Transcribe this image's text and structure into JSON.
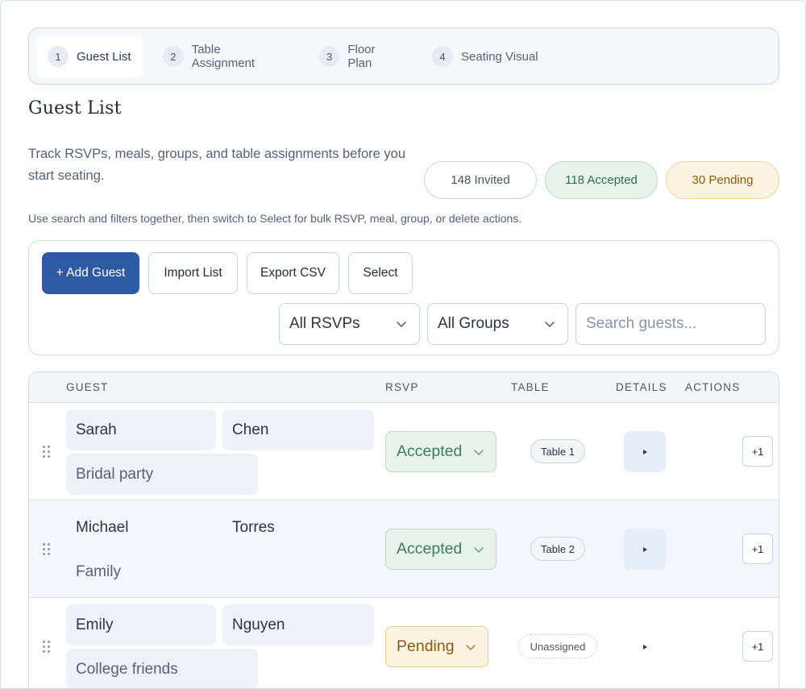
{
  "stepper": [
    {
      "num": "1",
      "label": "Guest List"
    },
    {
      "num": "2",
      "label": "Table Assignment"
    },
    {
      "num": "3",
      "label": "Floor Plan"
    },
    {
      "num": "4",
      "label": "Seating Visual"
    }
  ],
  "page_title": "Guest List",
  "intro": "Track RSVPs, meals, groups, and table assignments before you start seating.",
  "stats": {
    "invited": "148 Invited",
    "accepted": "118 Accepted",
    "pending": "30 Pending"
  },
  "hint": "Use search and filters together, then switch to Select for bulk RSVP, meal, group, or delete actions.",
  "toolbar": {
    "add_label": "+ Add Guest",
    "import_label": "Import List",
    "export_label": "Export CSV",
    "select_label": "Select",
    "rsvp_filter": "All RSVPs",
    "group_filter": "All Groups",
    "search_placeholder": "Search guests..."
  },
  "table": {
    "headers": {
      "guest": "GUEST",
      "rsvp": "RSVP",
      "table": "TABLE",
      "details": "DETAILS",
      "actions": "ACTIONS"
    },
    "rows": [
      {
        "first": "Sarah",
        "last": "Chen",
        "group": "Bridal party",
        "rsvp": "Accepted",
        "table": "Table 1",
        "plus": "+1"
      },
      {
        "first": "Michael",
        "last": "Torres",
        "group": "Family",
        "rsvp": "Accepted",
        "table": "Table 2",
        "plus": "+1"
      },
      {
        "first": "Emily",
        "last": "Nguyen",
        "group": "College friends",
        "rsvp": "Pending",
        "table": "Unassigned",
        "plus": "+1"
      }
    ]
  },
  "colors": {
    "primary": "#2e5aa3",
    "accepted": "#3d7d58",
    "pending": "#8a5a12"
  },
  "icons": {
    "chevron": "chevron-down-icon",
    "drag": "drag-handle-icon",
    "details": "expand-triangle-icon"
  }
}
